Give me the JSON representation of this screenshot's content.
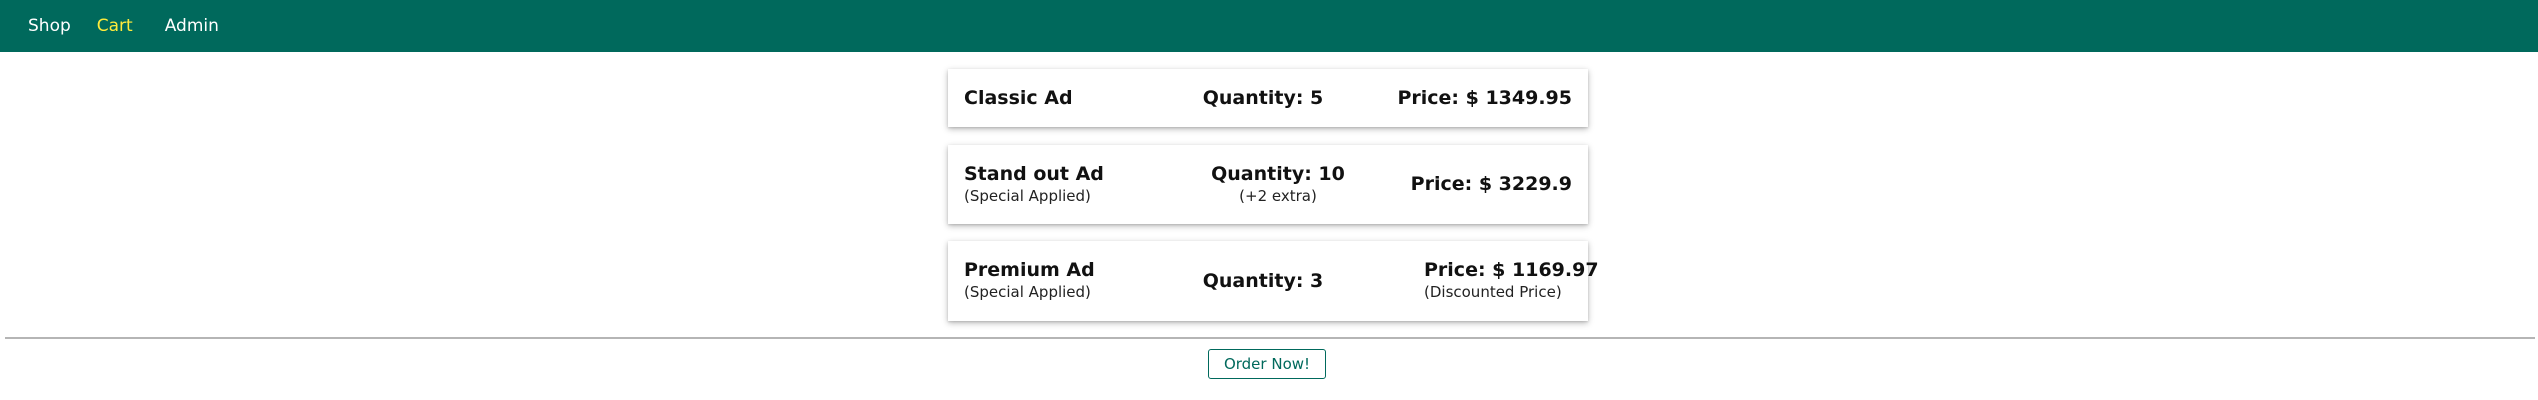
{
  "nav": {
    "items": [
      {
        "label": "Shop",
        "active": false
      },
      {
        "label": "Cart",
        "active": true
      },
      {
        "label": "Admin",
        "active": false
      }
    ],
    "background_color": "#00695c",
    "active_color": "#ffeb3b"
  },
  "cart": {
    "items": [
      {
        "name": "Classic Ad",
        "note": "",
        "quantity_label": "Quantity: 5",
        "quantity_note": "",
        "price_label": "Price: $ 1349.95",
        "price_note": ""
      },
      {
        "name": "Stand out Ad",
        "note": "(Special Applied)",
        "quantity_label": "Quantity: 10",
        "quantity_note": "(+2 extra)",
        "price_label": "Price: $ 3229.9",
        "price_note": ""
      },
      {
        "name": "Premium Ad",
        "note": "(Special Applied)",
        "quantity_label": "Quantity: 3",
        "quantity_note": "",
        "price_label": "Price: $ 1169.97",
        "price_note": "(Discounted Price)"
      }
    ]
  },
  "actions": {
    "order_label": "Order Now!"
  }
}
